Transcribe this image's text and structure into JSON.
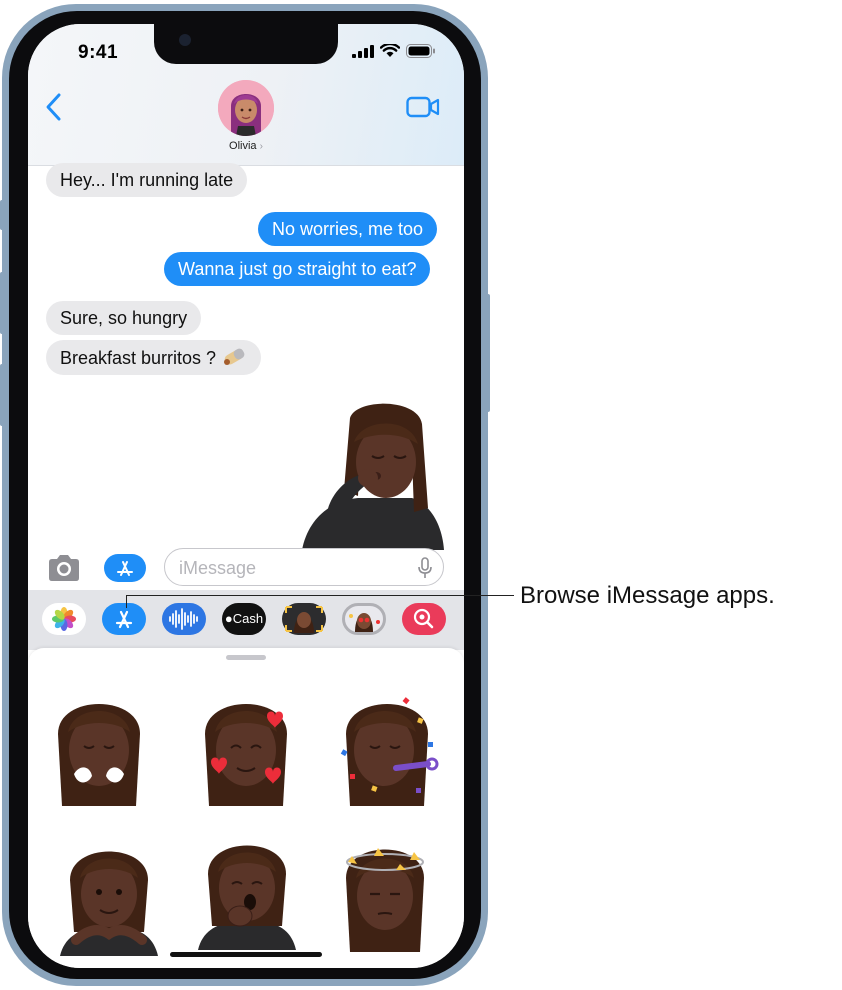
{
  "status_bar": {
    "time": "9:41"
  },
  "header": {
    "contact_name": "Olivia",
    "chevron": "›"
  },
  "messages": [
    {
      "direction": "in",
      "text": "Hey... I'm running late"
    },
    {
      "direction": "out",
      "text": "No worries, me too"
    },
    {
      "direction": "out",
      "text": "Wanna just go straight to eat?"
    },
    {
      "direction": "in",
      "text": "Sure, so hungry"
    },
    {
      "direction": "in",
      "text": "Breakfast burritos ?"
    }
  ],
  "compose": {
    "placeholder": "iMessage"
  },
  "app_drawer": {
    "apps": [
      {
        "name": "photos",
        "icon": "photos-icon"
      },
      {
        "name": "app-store",
        "icon": "app-store-icon"
      },
      {
        "name": "audio",
        "icon": "audio-waveform-icon"
      },
      {
        "name": "apple-cash",
        "icon": "apple-cash-icon",
        "label": "Cash"
      },
      {
        "name": "memoji",
        "icon": "memoji-icon"
      },
      {
        "name": "memoji-stickers",
        "icon": "memoji-stickers-icon"
      },
      {
        "name": "images-search",
        "icon": "images-search-icon"
      }
    ]
  },
  "callout": {
    "text": "Browse iMessage apps."
  },
  "colors": {
    "accent": "#1f8ef7",
    "bubble_in": "#e9e9eb",
    "frame": "#8aa4bc",
    "skin": "#5a3528",
    "hair": "#3f2214"
  }
}
